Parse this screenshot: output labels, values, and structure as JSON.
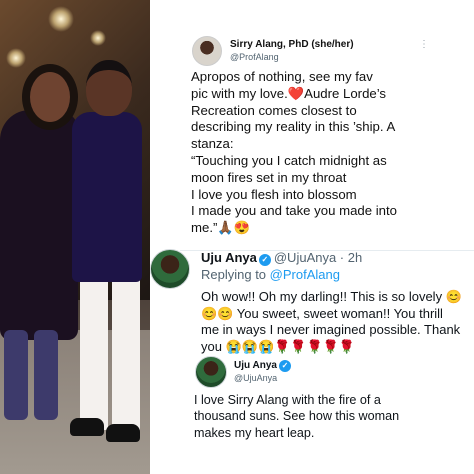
{
  "tweet1": {
    "author_name": "Sirry Alang, PhD (she/her)",
    "author_handle": "@ProfAlang",
    "more_label": "⋮",
    "lines": [
      "Apropos of nothing, see my fav",
      "pic with my love.❤️Audre Lorde’s",
      "Recreation comes closest to",
      "describing my reality in this ’ship. A",
      "stanza:",
      "“Touching you I catch midnight as",
      "moon fires set in my throat",
      "I love you flesh into blossom",
      "I made you and take you made into",
      "me.”🙏🏾😍"
    ]
  },
  "tweet2": {
    "author_name": "Uju Anya",
    "verified_mark": "✓",
    "author_handle": "@UjuAnya · 2h",
    "replying_prefix": "Replying to ",
    "replying_to": "@ProfAlang",
    "lines": [
      "Oh wow!! Oh my darling!! This is so lovely 😊",
      "😊😊 You sweet, sweet woman!! You thrill",
      "me in ways I never imagined possible. Thank",
      "you 😭😭😭🌹🌹🌹🌹🌹"
    ]
  },
  "tweet3": {
    "author_name": "Uju Anya",
    "verified_mark": "✓",
    "author_handle": "@UjuAnya",
    "lines": [
      "I love Sirry Alang with the fire of a",
      "thousand suns. See how this woman",
      "makes my heart leap."
    ]
  },
  "colors": {
    "link": "#1d9bf0",
    "verified": "#1d9bf0",
    "secondary_text": "#536471"
  }
}
